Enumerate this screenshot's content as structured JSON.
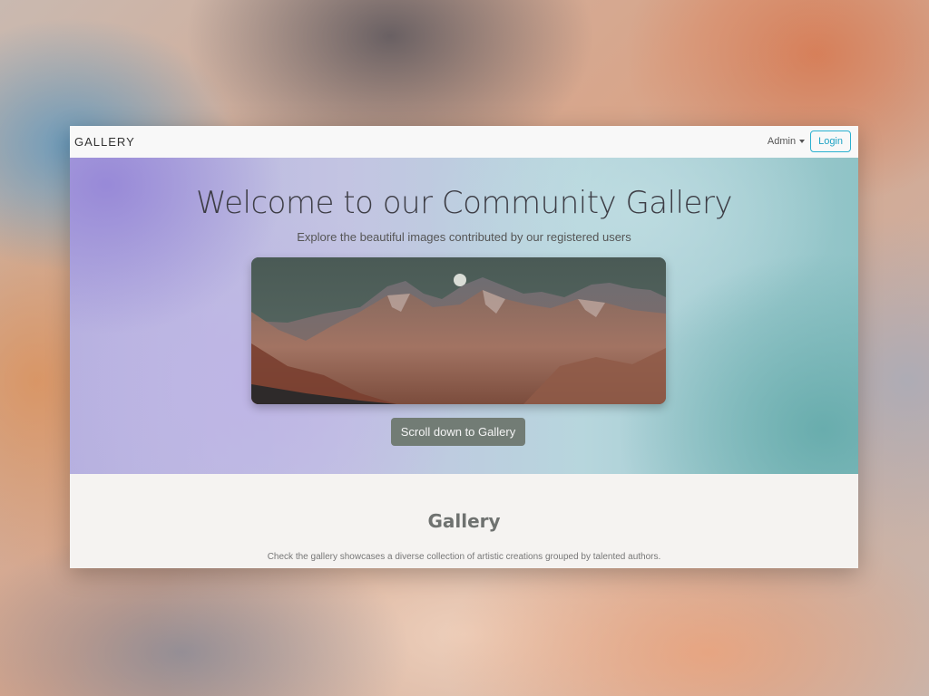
{
  "navbar": {
    "brand": "GALLERY",
    "admin_label": "Admin",
    "login_label": "Login"
  },
  "hero": {
    "title": "Welcome to our Community Gallery",
    "subtitle": "Explore the beautiful images contributed by our registered users",
    "image_subject": "mountain range at dusk with moon",
    "scroll_button_label": "Scroll down to Gallery"
  },
  "gallery": {
    "title": "Gallery",
    "description": "Check the gallery showcases a diverse collection of artistic creations grouped by talented authors."
  },
  "colors": {
    "login_accent": "#2ab0d0",
    "scroll_button_bg": "#727c75",
    "title_text": "#3d3d45"
  }
}
